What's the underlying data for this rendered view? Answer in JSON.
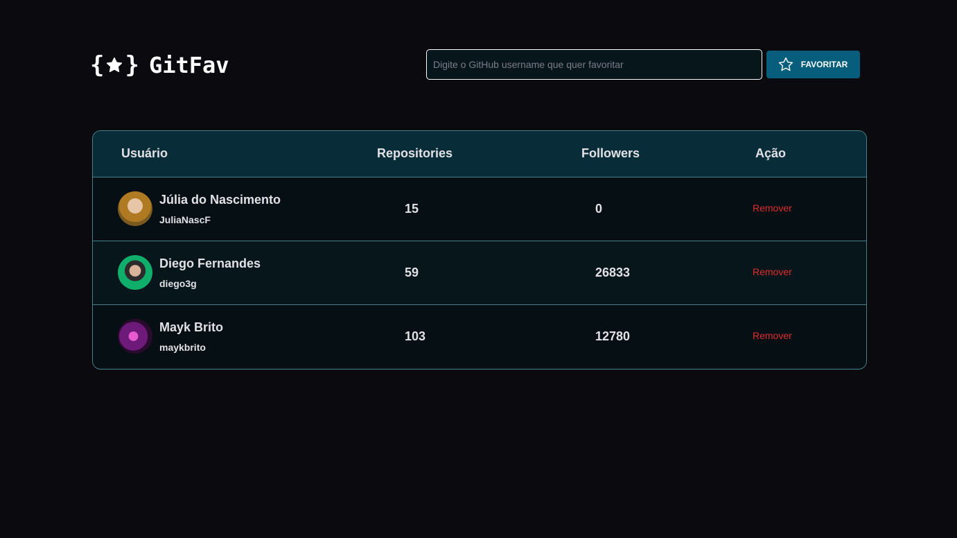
{
  "header": {
    "logo_text": "GitFav",
    "search_placeholder": "Digite o GitHub username que quer favoritar",
    "favorite_button_label": "FAVORITAR"
  },
  "table": {
    "columns": [
      "Usuário",
      "Repositories",
      "Followers",
      "Ação"
    ],
    "rows": [
      {
        "name": "Júlia do Nascimento",
        "login": "JuliaNascF",
        "repositories": "15",
        "followers": "0",
        "action": "Remover"
      },
      {
        "name": "Diego Fernandes",
        "login": "diego3g",
        "repositories": "59",
        "followers": "26833",
        "action": "Remover"
      },
      {
        "name": "Mayk Brito",
        "login": "maykbrito",
        "repositories": "103",
        "followers": "12780",
        "action": "Remover"
      }
    ]
  },
  "colors": {
    "background": "#0b0a0f",
    "header_row": "#092d38",
    "button": "#065e7c",
    "border": "#4a808c",
    "remove": "#e02c2c"
  },
  "icons": {
    "logo": "star-braces-icon",
    "favorite_button": "star-outline-icon"
  }
}
